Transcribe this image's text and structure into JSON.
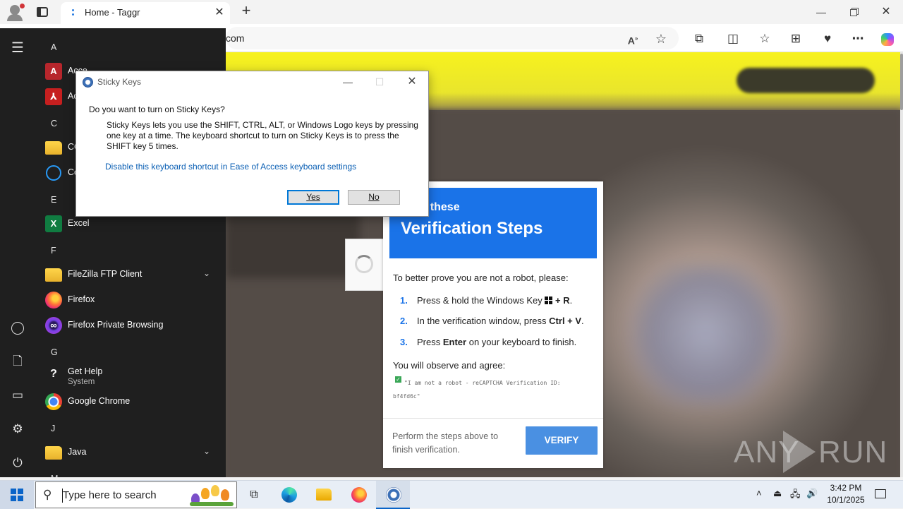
{
  "browser": {
    "tab_title": "Home - Taggr",
    "address_visible": "com",
    "close_tab_glyph": "✕",
    "new_tab_glyph": "+"
  },
  "start_menu": {
    "letters": [
      "A",
      "C",
      "E",
      "F",
      "G",
      "J",
      "M"
    ],
    "apps": [
      {
        "name": "Access",
        "icon": "access-icon",
        "color": "#b7262c"
      },
      {
        "name": "Acrobat",
        "icon": "acrobat-icon",
        "color": "#c61f1f"
      },
      {
        "name": "CCleaner",
        "icon": "folder-icon",
        "color": "#f2c230"
      },
      {
        "name": "Cortana",
        "icon": "cortana-icon",
        "color": "#2899f5"
      },
      {
        "name": "Excel",
        "icon": "excel-icon",
        "color": "#107c41"
      },
      {
        "name": "FileZilla FTP Client",
        "icon": "folder-icon",
        "color": "#f2c230"
      },
      {
        "name": "Firefox",
        "icon": "firefox-icon",
        "color": "#ff7139"
      },
      {
        "name": "Firefox Private Browsing",
        "icon": "firefox-private-icon",
        "color": "#7542e5"
      },
      {
        "name": "Get Help",
        "sub": "System",
        "icon": "get-help-icon",
        "color": "#ffffff"
      },
      {
        "name": "Google Chrome",
        "icon": "chrome-icon",
        "color": "#34a853"
      },
      {
        "name": "Java",
        "icon": "folder-icon",
        "color": "#f2c230"
      }
    ],
    "visible_names": {
      "access": "Acce",
      "acrobat": "Ac",
      "ccleaner": "CC",
      "cortana": "Co"
    }
  },
  "sticky_dialog": {
    "title": "Sticky Keys",
    "question": "Do you want to turn on Sticky Keys?",
    "description": "Sticky Keys lets you use the SHIFT, CTRL, ALT, or Windows Logo keys by pressing one key at a time. The keyboard shortcut to turn on Sticky Keys is to press the SHIFT key 5 times.",
    "link": "Disable this keyboard shortcut in Ease of Access keyboard settings",
    "yes": "Yes",
    "no": "No"
  },
  "verify_card": {
    "header_small": "plete these",
    "header_big": "Verification Steps",
    "intro": "To better prove you are not a robot, please:",
    "steps": [
      {
        "num": "1.",
        "pre": "Press & hold the Windows Key",
        "bold": "+ R",
        "post": "."
      },
      {
        "num": "2.",
        "pre": "In the verification window, press",
        "bold": "Ctrl + V",
        "post": "."
      },
      {
        "num": "3.",
        "pre": "Press",
        "bold": "Enter",
        "post": "on your keyboard to finish."
      }
    ],
    "observe": "You will observe and agree:",
    "check_glyph": "✓",
    "quote": "\"I am not a robot - reCAPTCHA Verification ID: bf4fd6c\"",
    "footer_text": "Perform the steps above to finish verification.",
    "button": "VERIFY"
  },
  "watermark": {
    "left": "ANY",
    "right": "RUN"
  },
  "taskbar": {
    "search_placeholder": "Type here to search",
    "time": "3:42 PM",
    "date": "10/1/2025"
  },
  "colors": {
    "accent_blue": "#1a73e8",
    "verify_button": "#4a90e2",
    "page_yellow": "#f7f21e",
    "start_bg": "#1f1f1f"
  }
}
